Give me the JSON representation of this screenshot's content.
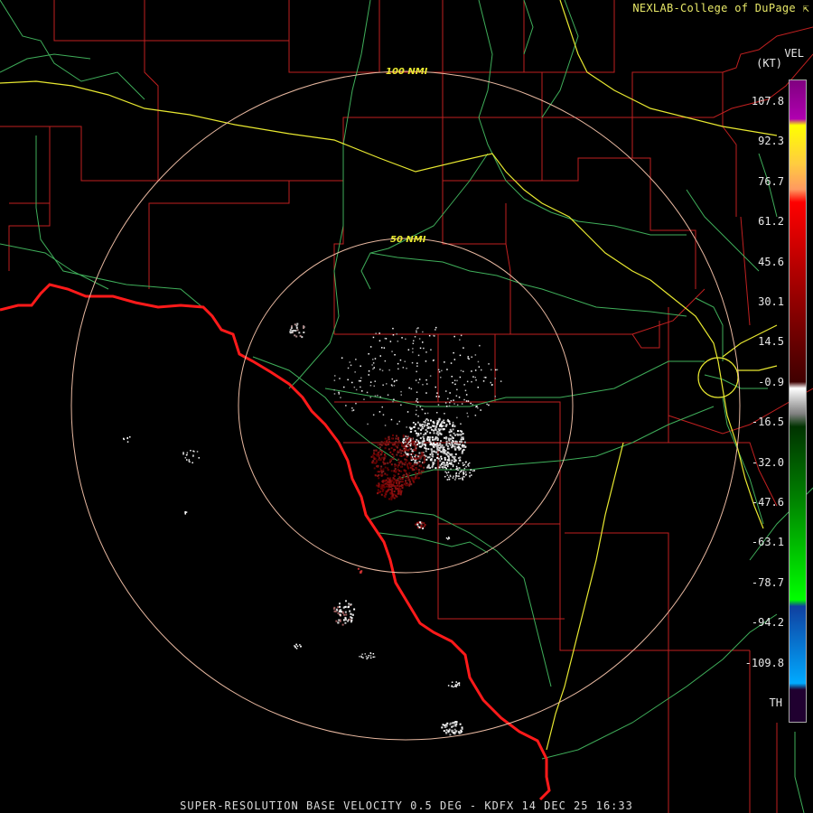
{
  "header": {
    "brand": "NEXLAB-College of DuPage"
  },
  "footer": {
    "caption": "SUPER-RESOLUTION BASE VELOCITY 0.5 DEG - KDFX 14 DEC 25 16:33"
  },
  "map": {
    "range_ring_labels": [
      "100 NMI",
      "50 NMI"
    ],
    "colors": {
      "boundary": "#c02020",
      "border": "#ff1a1a",
      "road": "#3fae5a",
      "interstate": "#e8e830",
      "range_ring": "#e8b8a0"
    }
  },
  "legend": {
    "product": "VEL",
    "unit": "(KT)",
    "ticks": [
      "107.8",
      "92.3",
      "76.7",
      "61.2",
      "45.6",
      "30.1",
      "14.5",
      "-0.9",
      "-16.5",
      "-32.0",
      "-47.6",
      "-63.1",
      "-78.7",
      "-94.2",
      "-109.8"
    ],
    "th_label": "TH",
    "gradient_stops": [
      {
        "color": "#800080",
        "pos": 0
      },
      {
        "color": "#b000b0",
        "pos": 6
      },
      {
        "color": "#ffff00",
        "pos": 7
      },
      {
        "color": "#ffcc40",
        "pos": 13
      },
      {
        "color": "#ff9960",
        "pos": 17
      },
      {
        "color": "#ff0000",
        "pos": 19
      },
      {
        "color": "#b00000",
        "pos": 30
      },
      {
        "color": "#600000",
        "pos": 42
      },
      {
        "color": "#400000",
        "pos": 47
      },
      {
        "color": "#ffffff",
        "pos": 48
      },
      {
        "color": "#808080",
        "pos": 52
      },
      {
        "color": "#003300",
        "pos": 54
      },
      {
        "color": "#008000",
        "pos": 65
      },
      {
        "color": "#00ff00",
        "pos": 81
      },
      {
        "color": "#1040a0",
        "pos": 82
      },
      {
        "color": "#00aaff",
        "pos": 94
      },
      {
        "color": "#200030",
        "pos": 95
      },
      {
        "color": "#200030",
        "pos": 100
      }
    ]
  }
}
